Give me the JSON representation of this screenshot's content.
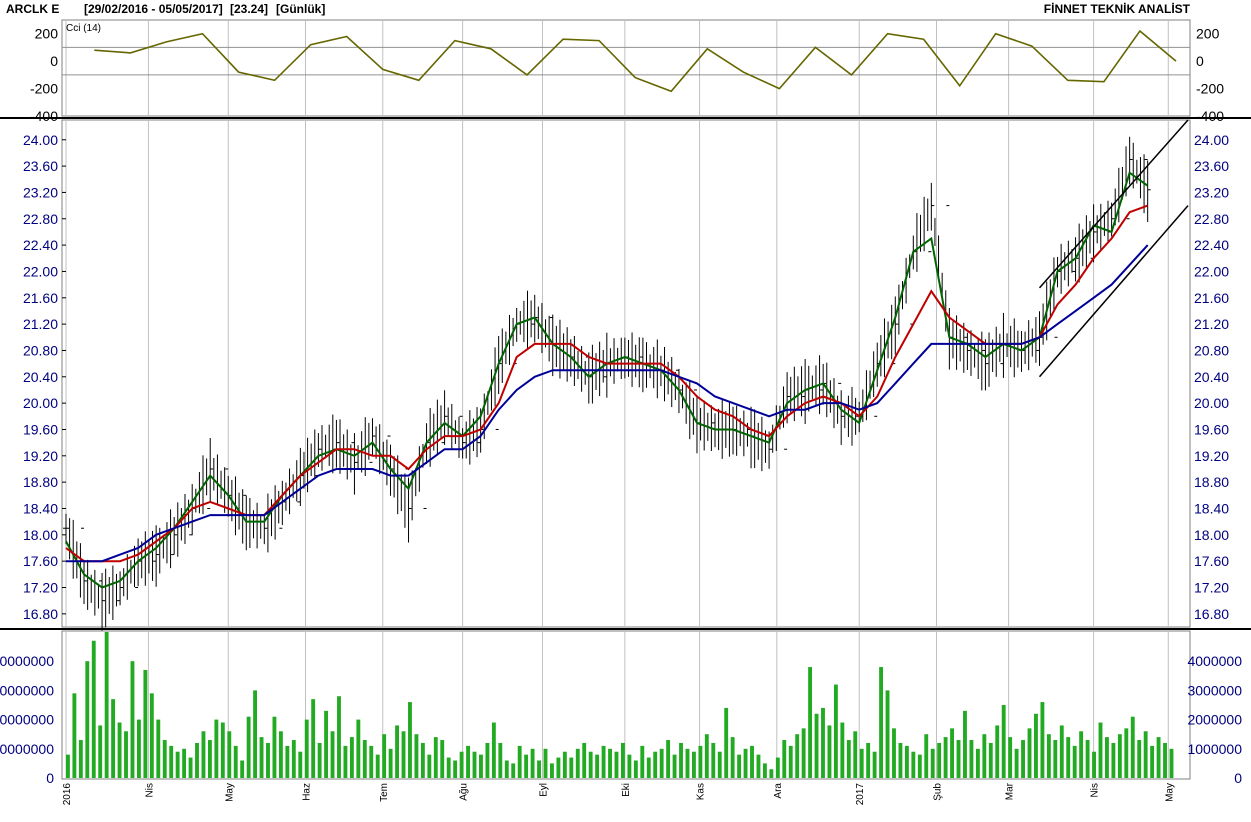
{
  "header": {
    "symbol": "ARCLK E",
    "range": "[29/02/2016 - 05/05/2017]",
    "last": "[23.24]",
    "period": "[Günlük]",
    "brand": "FİNNET TEKNİK ANALİST"
  },
  "colors": {
    "bar": "#000000",
    "ma_short": "#006400",
    "ma_mid": "#c00000",
    "ma_long": "#000099",
    "cci": "#666600",
    "volume": "#22aa22",
    "grid": "#c0c0c0",
    "channel": "#000000"
  },
  "chart_data": [
    {
      "type": "line",
      "title": "Cci (14)",
      "ylim": [
        -400,
        300
      ],
      "reference_lines": [
        100,
        -100
      ],
      "tick_labels": [
        "200",
        "0",
        "-200",
        "-400"
      ],
      "tick_values": [
        200,
        0,
        -200,
        -400
      ],
      "x": [
        "2016-03-11",
        "2016-03-25",
        "2016-04-08",
        "2016-04-22",
        "2016-05-06",
        "2016-05-20",
        "2016-06-03",
        "2016-06-17",
        "2016-07-01",
        "2016-07-15",
        "2016-07-29",
        "2016-08-12",
        "2016-08-26",
        "2016-09-09",
        "2016-09-23",
        "2016-10-07",
        "2016-10-21",
        "2016-11-04",
        "2016-11-18",
        "2016-12-02",
        "2016-12-16",
        "2016-12-30",
        "2017-01-13",
        "2017-01-27",
        "2017-02-10",
        "2017-02-24",
        "2017-03-10",
        "2017-03-24",
        "2017-04-07",
        "2017-04-21",
        "2017-05-05"
      ],
      "values": [
        80,
        60,
        140,
        200,
        -80,
        -140,
        120,
        180,
        -60,
        -140,
        150,
        90,
        -100,
        160,
        150,
        -120,
        -220,
        90,
        -80,
        -200,
        100,
        -100,
        200,
        160,
        -180,
        200,
        110,
        -140,
        -150,
        220,
        0
      ]
    },
    {
      "type": "bar",
      "subtype": "ohlc",
      "ylim": [
        16.6,
        24.3
      ],
      "tick_labels": [
        "24.00",
        "23.60",
        "23.20",
        "22.80",
        "22.40",
        "22.00",
        "21.60",
        "21.20",
        "20.80",
        "20.40",
        "20.00",
        "19.60",
        "19.20",
        "18.80",
        "18.40",
        "18.00",
        "17.60",
        "17.20",
        "16.80"
      ],
      "tick_values": [
        24.0,
        23.6,
        23.2,
        22.8,
        22.4,
        22.0,
        21.6,
        21.2,
        20.8,
        20.4,
        20.0,
        19.6,
        19.2,
        18.8,
        18.4,
        18.0,
        17.6,
        17.2,
        16.8
      ],
      "x_tick_labels": [
        "2016",
        "Nis",
        "May",
        "Haz",
        "Tem",
        "Ağu",
        "Eyl",
        "Eki",
        "Kas",
        "Ara",
        "2017",
        "Şub",
        "Mar",
        "Nis",
        "May"
      ],
      "x_tick_dates": [
        "2016-02-29",
        "2016-04-01",
        "2016-05-02",
        "2016-06-01",
        "2016-07-01",
        "2016-08-01",
        "2016-09-01",
        "2016-10-03",
        "2016-11-01",
        "2016-12-01",
        "2017-01-02",
        "2017-02-01",
        "2017-03-01",
        "2017-04-03",
        "2017-05-02"
      ],
      "x": [
        "2016-02-29",
        "2016-03-07",
        "2016-03-14",
        "2016-03-21",
        "2016-03-28",
        "2016-04-04",
        "2016-04-11",
        "2016-04-18",
        "2016-04-25",
        "2016-05-02",
        "2016-05-09",
        "2016-05-16",
        "2016-05-23",
        "2016-05-30",
        "2016-06-06",
        "2016-06-13",
        "2016-06-20",
        "2016-06-27",
        "2016-07-04",
        "2016-07-11",
        "2016-07-18",
        "2016-07-25",
        "2016-08-01",
        "2016-08-08",
        "2016-08-15",
        "2016-08-22",
        "2016-08-29",
        "2016-09-05",
        "2016-09-12",
        "2016-09-19",
        "2016-09-26",
        "2016-10-03",
        "2016-10-10",
        "2016-10-17",
        "2016-10-24",
        "2016-10-31",
        "2016-11-07",
        "2016-11-14",
        "2016-11-21",
        "2016-11-28",
        "2016-12-05",
        "2016-12-12",
        "2016-12-19",
        "2016-12-26",
        "2017-01-02",
        "2017-01-09",
        "2017-01-16",
        "2017-01-23",
        "2017-01-30",
        "2017-02-06",
        "2017-02-13",
        "2017-02-20",
        "2017-02-27",
        "2017-03-06",
        "2017-03-13",
        "2017-03-20",
        "2017-03-27",
        "2017-04-03",
        "2017-04-10",
        "2017-04-17",
        "2017-04-24",
        "2017-05-01",
        "2017-05-05"
      ],
      "series": [
        {
          "name": "",
          "role": "close",
          "values": [
            18.1,
            17.3,
            17.0,
            17.2,
            17.6,
            17.7,
            18.0,
            18.4,
            19.0,
            18.6,
            18.2,
            18.1,
            18.5,
            18.9,
            19.3,
            19.4,
            19.1,
            19.5,
            19.0,
            18.4,
            19.4,
            19.8,
            19.4,
            19.6,
            20.6,
            21.2,
            21.3,
            20.9,
            20.7,
            20.4,
            20.6,
            20.7,
            20.6,
            20.5,
            20.2,
            19.7,
            19.6,
            19.6,
            19.5,
            19.3,
            20.1,
            20.2,
            20.3,
            19.8,
            19.8,
            20.6,
            21.2,
            22.3,
            23.0,
            21.0,
            20.8,
            20.6,
            20.9,
            20.8,
            21.0,
            22.0,
            22.2,
            22.6,
            22.8,
            23.7,
            23.24
          ]
        },
        {
          "name": "",
          "role": "ma_short",
          "values": [
            17.9,
            17.4,
            17.2,
            17.3,
            17.6,
            17.8,
            18.1,
            18.5,
            18.9,
            18.6,
            18.2,
            18.2,
            18.6,
            18.9,
            19.2,
            19.3,
            19.2,
            19.4,
            19.0,
            18.7,
            19.4,
            19.7,
            19.5,
            19.8,
            20.6,
            21.2,
            21.3,
            20.9,
            20.7,
            20.4,
            20.6,
            20.7,
            20.6,
            20.5,
            20.2,
            19.7,
            19.6,
            19.6,
            19.5,
            19.4,
            20.0,
            20.2,
            20.3,
            19.9,
            19.7,
            20.5,
            21.3,
            22.3,
            22.5,
            21.0,
            20.9,
            20.7,
            20.9,
            20.8,
            21.0,
            22.0,
            22.2,
            22.7,
            22.6,
            23.5,
            23.3
          ]
        },
        {
          "name": "",
          "role": "ma_mid",
          "values": [
            17.8,
            17.6,
            17.6,
            17.6,
            17.7,
            17.9,
            18.1,
            18.4,
            18.5,
            18.4,
            18.3,
            18.3,
            18.6,
            18.9,
            19.1,
            19.3,
            19.3,
            19.2,
            19.2,
            19.0,
            19.3,
            19.5,
            19.5,
            19.6,
            20.0,
            20.7,
            20.9,
            20.9,
            20.9,
            20.7,
            20.6,
            20.6,
            20.6,
            20.6,
            20.4,
            20.1,
            19.9,
            19.8,
            19.6,
            19.5,
            19.8,
            20.0,
            20.1,
            20.0,
            19.8,
            20.1,
            20.7,
            21.2,
            21.7,
            21.3,
            21.1,
            20.9,
            20.9,
            20.9,
            21.0,
            21.5,
            21.8,
            22.2,
            22.5,
            22.9,
            23.0
          ]
        },
        {
          "name": "",
          "role": "ma_long",
          "values": [
            17.6,
            17.6,
            17.6,
            17.7,
            17.8,
            18.0,
            18.1,
            18.2,
            18.3,
            18.3,
            18.3,
            18.3,
            18.5,
            18.7,
            18.9,
            19.0,
            19.0,
            19.0,
            18.9,
            18.9,
            19.1,
            19.3,
            19.3,
            19.5,
            19.9,
            20.2,
            20.4,
            20.5,
            20.5,
            20.5,
            20.5,
            20.5,
            20.5,
            20.5,
            20.4,
            20.3,
            20.1,
            20.0,
            19.9,
            19.8,
            19.9,
            19.9,
            20.0,
            20.0,
            19.9,
            20.0,
            20.3,
            20.6,
            20.9,
            20.9,
            20.9,
            20.9,
            20.9,
            20.9,
            21.0,
            21.2,
            21.4,
            21.6,
            21.8,
            22.1,
            22.4
          ]
        }
      ],
      "channel": {
        "upper": [
          [
            "2017-03-13",
            21.75
          ],
          [
            "2017-05-05",
            24.3
          ]
        ],
        "lower": [
          [
            "2017-03-13",
            20.4
          ],
          [
            "2017-05-05",
            23.0
          ]
        ]
      }
    },
    {
      "type": "bar",
      "title": "",
      "ylim": [
        0,
        5000000
      ],
      "tick_labels": [
        "4000000",
        "3000000",
        "2000000",
        "1000000",
        "0"
      ],
      "tick_values": [
        4000000,
        3000000,
        2000000,
        1000000,
        0
      ],
      "left_tick_labels": [
        "0000000",
        "0000000",
        "0000000",
        "0000000",
        "0"
      ],
      "values": [
        800000,
        2900000,
        1300000,
        4000000,
        4700000,
        1800000,
        5000000,
        2700000,
        1900000,
        1600000,
        4000000,
        2000000,
        3700000,
        2900000,
        2000000,
        1300000,
        1100000,
        900000,
        1000000,
        700000,
        1200000,
        1600000,
        1300000,
        2000000,
        1900000,
        1600000,
        1100000,
        600000,
        2100000,
        3000000,
        1400000,
        1200000,
        2100000,
        1600000,
        1100000,
        1300000,
        900000,
        2000000,
        2700000,
        1200000,
        2300000,
        1600000,
        2800000,
        1100000,
        1400000,
        2000000,
        1300000,
        1100000,
        800000,
        1500000,
        1000000,
        1800000,
        1600000,
        2600000,
        1500000,
        1200000,
        800000,
        1400000,
        1300000,
        700000,
        600000,
        900000,
        1100000,
        900000,
        800000,
        1200000,
        1900000,
        1200000,
        600000,
        500000,
        1100000,
        800000,
        1000000,
        600000,
        1000000,
        500000,
        700000,
        900000,
        700000,
        1000000,
        1200000,
        900000,
        800000,
        1100000,
        1000000,
        900000,
        1200000,
        800000,
        600000,
        1100000,
        700000,
        900000,
        1000000,
        1300000,
        800000,
        1200000,
        1000000,
        900000,
        1100000,
        1500000,
        1200000,
        900000,
        2400000,
        1400000,
        800000,
        1000000,
        1100000,
        800000,
        500000,
        300000,
        700000,
        1300000,
        1100000,
        1500000,
        1700000,
        3800000,
        2200000,
        2400000,
        1800000,
        3200000,
        1900000,
        1300000,
        1600000,
        1000000,
        1200000,
        900000,
        3800000,
        3000000,
        1700000,
        1200000,
        1100000,
        900000,
        800000,
        1500000,
        1000000,
        1200000,
        1400000,
        1700000,
        1300000,
        2300000,
        1300000,
        1000000,
        1500000,
        1200000,
        1800000,
        2500000,
        1400000,
        1000000,
        1300000,
        1700000,
        2200000,
        2600000,
        1500000,
        1300000,
        1800000,
        1400000,
        1100000,
        1600000,
        1300000,
        900000,
        1900000,
        1400000,
        1200000,
        1500000,
        1700000,
        2100000,
        1300000,
        1600000,
        1100000,
        1400000,
        1200000,
        1000000
      ]
    }
  ]
}
